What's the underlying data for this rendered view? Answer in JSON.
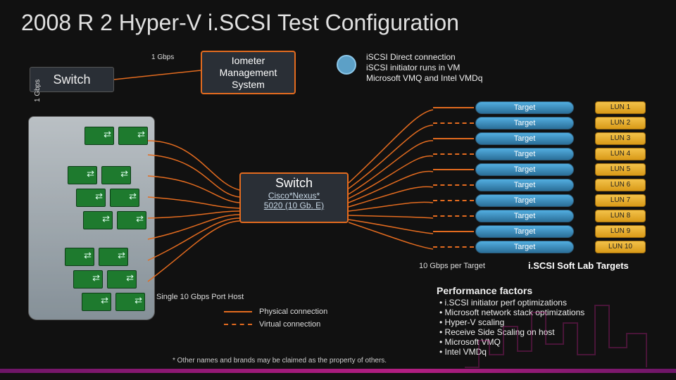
{
  "title": "2008 R 2 Hyper-V i.SCSI Test Configuration",
  "labels": {
    "switch1": "Switch",
    "one_gbps": "1 Gbps",
    "one_gbps_v": "1 Gbps",
    "iometer_l1": "Iometer",
    "iometer_l2": "Management",
    "iometer_l3": "System",
    "iscsi_l1": "iSCSI Direct connection",
    "iscsi_l2": "iSCSI initiator runs in VM",
    "iscsi_l3": "Microsoft VMQ and Intel VMDq",
    "switch2_hdr": "Switch",
    "switch2_l1": "Cisco*Nexus*",
    "switch2_l2": "5020 (10 Gb. E)",
    "ten_gbps_per_target": "10 Gbps per Target",
    "iscsi_soft": "i.SCSI Soft  Lab Targets",
    "host": "Single 10 Gbps Port Host",
    "legend_phys": "Physical connection",
    "legend_virt": "Virtual connection",
    "footnote": "* Other names and brands may be claimed as the property of others."
  },
  "targets": [
    {
      "name": "Target",
      "lun": "LUN 1",
      "conn": "solid"
    },
    {
      "name": "Target",
      "lun": "LUN 2",
      "conn": "dashed"
    },
    {
      "name": "Target",
      "lun": "LUN 3",
      "conn": "solid"
    },
    {
      "name": "Target",
      "lun": "LUN 4",
      "conn": "dashed"
    },
    {
      "name": "Target",
      "lun": "LUN 5",
      "conn": "solid"
    },
    {
      "name": "Target",
      "lun": "LUN 6",
      "conn": "dashed"
    },
    {
      "name": "Target",
      "lun": "LUN 7",
      "conn": "dashed"
    },
    {
      "name": "Target",
      "lun": "LUN 8",
      "conn": "dashed"
    },
    {
      "name": "Target",
      "lun": "LUN 9",
      "conn": "solid"
    },
    {
      "name": "Target",
      "lun": "LUN 10",
      "conn": "dashed"
    }
  ],
  "perf": {
    "header": "Performance factors",
    "items": [
      "i.SCSI initiator perf optimizations",
      "Microsoft network stack optimizations",
      "Hyper-V scaling",
      "Receive Side Scaling on host",
      "Microsoft VMQ",
      "Intel VMDq"
    ]
  }
}
